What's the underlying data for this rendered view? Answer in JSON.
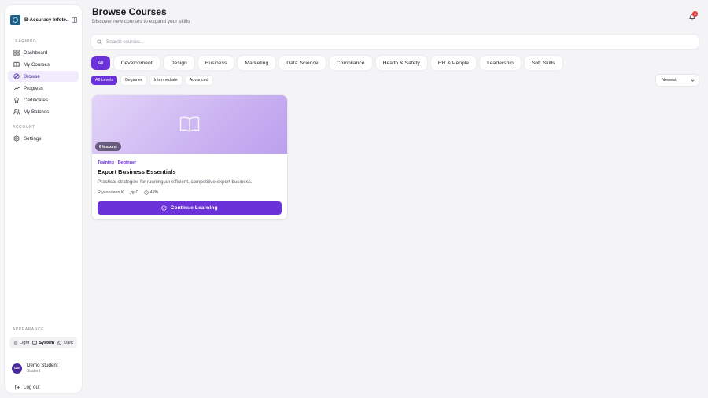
{
  "sidebar": {
    "brand_name": "B-Accuracy Infote...",
    "learning_label": "LEARNING",
    "account_label": "ACCOUNT",
    "items": [
      {
        "label": "Dashboard",
        "icon": "grid-icon"
      },
      {
        "label": "My Courses",
        "icon": "book-open-icon"
      },
      {
        "label": "Browse",
        "icon": "compass-icon",
        "active": true
      },
      {
        "label": "Progress",
        "icon": "trending-up-icon"
      },
      {
        "label": "Certificates",
        "icon": "award-icon"
      },
      {
        "label": "My Batches",
        "icon": "users-icon"
      }
    ],
    "account_items": [
      {
        "label": "Settings",
        "icon": "gear-icon"
      }
    ],
    "appearance_label": "APPEARANCE",
    "appearance_options": [
      "Light",
      "System",
      "Dark"
    ],
    "appearance_selected": "System",
    "user": {
      "initials": "DS",
      "name": "Demo Student",
      "role": "Student"
    },
    "logout_label": "Log out"
  },
  "header": {
    "title": "Browse Courses",
    "subtitle": "Discover new courses to expand your skills",
    "notification_count": "3"
  },
  "search": {
    "placeholder": "Search courses..."
  },
  "categories": [
    "All",
    "Development",
    "Design",
    "Business",
    "Marketing",
    "Data Science",
    "Compliance",
    "Health & Safety",
    "HR & People",
    "Leadership",
    "Soft Skills"
  ],
  "category_selected": "All",
  "levels": [
    "All Levels",
    "Beginner",
    "Intermediate",
    "Advanced"
  ],
  "level_selected": "All Levels",
  "sort": {
    "value": "Newest"
  },
  "courses": [
    {
      "lessons": "6 lessons",
      "category_level": "Training · Beginner",
      "title": "Export Business Essentials",
      "description": "Practical strategies for running an efficient, competitive export business.",
      "author": "Riyasudeen K",
      "enrolled": "0",
      "duration": "4.8h",
      "button_label": "Continue Learning"
    }
  ],
  "colors": {
    "accent": "#6a32d8",
    "brand": "#1f5f86",
    "badge": "#e0413a"
  }
}
